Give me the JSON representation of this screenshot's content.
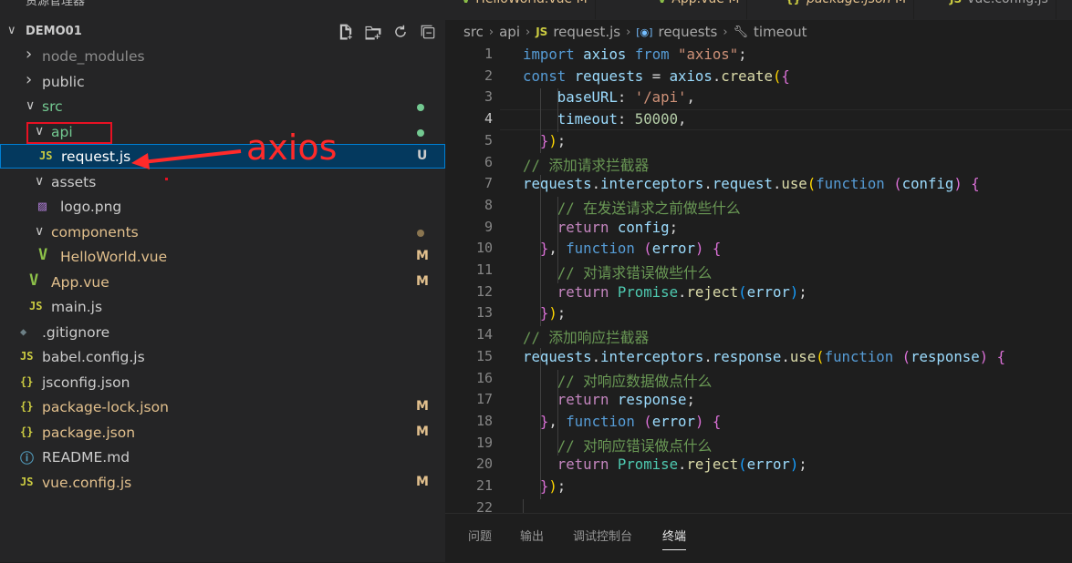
{
  "explorer": {
    "title": "资源管理器",
    "project": "DEMO01",
    "actions": [
      "new-file-icon",
      "new-folder-icon",
      "refresh-icon",
      "collapse-all-icon"
    ],
    "items": [
      {
        "name": "node_modules",
        "type": "folder",
        "open": false,
        "depth": 1,
        "color": "#8c8c8c"
      },
      {
        "name": "public",
        "type": "folder",
        "open": false,
        "depth": 1,
        "color": "#cccccc"
      },
      {
        "name": "src",
        "type": "folder",
        "open": true,
        "depth": 1,
        "color": "#73c991",
        "dot": "#73c991"
      },
      {
        "name": "api",
        "type": "folder",
        "open": true,
        "depth": 2,
        "color": "#73c991",
        "dot": "#73c991"
      },
      {
        "name": "request.js",
        "type": "js",
        "depth": 3,
        "color": "#ffffff",
        "status": "U",
        "statusColor": "#cccccc",
        "selected": true
      },
      {
        "name": "assets",
        "type": "folder",
        "open": true,
        "depth": 2,
        "color": "#cccccc"
      },
      {
        "name": "logo.png",
        "type": "image",
        "depth": 3,
        "color": "#cccccc"
      },
      {
        "name": "components",
        "type": "folder",
        "open": true,
        "depth": 2,
        "color": "#e2c08d",
        "dot": "#8a7550"
      },
      {
        "name": "HelloWorld.vue",
        "type": "vue",
        "depth": 3,
        "color": "#e2c08d",
        "status": "M",
        "statusColor": "#e2c08d"
      },
      {
        "name": "App.vue",
        "type": "vue",
        "depth": 2,
        "color": "#e2c08d",
        "status": "M",
        "statusColor": "#e2c08d"
      },
      {
        "name": "main.js",
        "type": "js",
        "depth": 2,
        "color": "#cccccc"
      },
      {
        "name": ".gitignore",
        "type": "git",
        "depth": 1,
        "color": "#cccccc"
      },
      {
        "name": "babel.config.js",
        "type": "js",
        "depth": 1,
        "color": "#cccccc"
      },
      {
        "name": "jsconfig.json",
        "type": "json",
        "depth": 1,
        "color": "#cccccc"
      },
      {
        "name": "package-lock.json",
        "type": "json",
        "depth": 1,
        "color": "#e2c08d",
        "status": "M",
        "statusColor": "#e2c08d"
      },
      {
        "name": "package.json",
        "type": "json",
        "depth": 1,
        "color": "#e2c08d",
        "status": "M",
        "statusColor": "#e2c08d"
      },
      {
        "name": "README.md",
        "type": "info",
        "depth": 1,
        "color": "#cccccc"
      },
      {
        "name": "vue.config.js",
        "type": "js",
        "depth": 1,
        "color": "#e2c08d",
        "status": "M",
        "statusColor": "#e2c08d"
      }
    ]
  },
  "annotation": {
    "text": "axios"
  },
  "tabs": [
    {
      "label": "HelloWorld.vue",
      "status": "M",
      "icon": "vue"
    },
    {
      "label": "App.vue",
      "status": "M",
      "icon": "vue"
    },
    {
      "label": "package.json",
      "status": "M",
      "icon": "json"
    },
    {
      "label": "vue.config.js",
      "status": "",
      "icon": "js"
    }
  ],
  "breadcrumb": {
    "parts": [
      "src",
      "api",
      "request.js",
      "requests",
      "timeout"
    ]
  },
  "editor": {
    "current_line": 4,
    "lines": [
      {
        "n": "1",
        "tokens": [
          [
            "k",
            "import"
          ],
          [
            "p",
            " "
          ],
          [
            "v",
            "axios"
          ],
          [
            "p",
            " "
          ],
          [
            "k",
            "from"
          ],
          [
            "p",
            " "
          ],
          [
            "s",
            "\"axios\""
          ],
          [
            "p",
            ";"
          ]
        ]
      },
      {
        "n": "2",
        "tokens": [
          [
            "k",
            "const"
          ],
          [
            "p",
            " "
          ],
          [
            "v",
            "requests"
          ],
          [
            "p",
            " = "
          ],
          [
            "v",
            "axios"
          ],
          [
            "p",
            "."
          ],
          [
            "f",
            "create"
          ],
          [
            "b1",
            "("
          ],
          [
            "b2",
            "{"
          ]
        ]
      },
      {
        "n": "3",
        "tokens": [
          [
            "p",
            "    "
          ],
          [
            "v",
            "baseURL"
          ],
          [
            "p",
            ": "
          ],
          [
            "s",
            "'/api'"
          ],
          [
            "p",
            ","
          ]
        ]
      },
      {
        "n": "4",
        "tokens": [
          [
            "p",
            "    "
          ],
          [
            "v",
            "timeout"
          ],
          [
            "p",
            ": "
          ],
          [
            "n",
            "50000"
          ],
          [
            "p",
            ","
          ]
        ]
      },
      {
        "n": "5",
        "tokens": [
          [
            "p",
            "  "
          ],
          [
            "b2",
            "}"
          ],
          [
            "b1",
            ")"
          ],
          [
            "p",
            ";"
          ]
        ]
      },
      {
        "n": "6",
        "tokens": [
          [
            "cm",
            "// 添加请求拦截器"
          ]
        ]
      },
      {
        "n": "7",
        "tokens": [
          [
            "v",
            "requests"
          ],
          [
            "p",
            "."
          ],
          [
            "v",
            "interceptors"
          ],
          [
            "p",
            "."
          ],
          [
            "v",
            "request"
          ],
          [
            "p",
            "."
          ],
          [
            "f",
            "use"
          ],
          [
            "b1",
            "("
          ],
          [
            "k",
            "function"
          ],
          [
            "p",
            " "
          ],
          [
            "b2",
            "("
          ],
          [
            "v",
            "config"
          ],
          [
            "b2",
            ")"
          ],
          [
            "p",
            " "
          ],
          [
            "b2",
            "{"
          ]
        ]
      },
      {
        "n": "8",
        "tokens": [
          [
            "p",
            "    "
          ],
          [
            "cm",
            "// 在发送请求之前做些什么"
          ]
        ]
      },
      {
        "n": "9",
        "tokens": [
          [
            "p",
            "    "
          ],
          [
            "c",
            "return"
          ],
          [
            "p",
            " "
          ],
          [
            "v",
            "config"
          ],
          [
            "p",
            ";"
          ]
        ]
      },
      {
        "n": "10",
        "tokens": [
          [
            "p",
            "  "
          ],
          [
            "b2",
            "}"
          ],
          [
            "p",
            ", "
          ],
          [
            "k",
            "function"
          ],
          [
            "p",
            " "
          ],
          [
            "b2",
            "("
          ],
          [
            "v",
            "error"
          ],
          [
            "b2",
            ")"
          ],
          [
            "p",
            " "
          ],
          [
            "b2",
            "{"
          ]
        ]
      },
      {
        "n": "11",
        "tokens": [
          [
            "p",
            "    "
          ],
          [
            "cm",
            "// 对请求错误做些什么"
          ]
        ]
      },
      {
        "n": "12",
        "tokens": [
          [
            "p",
            "    "
          ],
          [
            "c",
            "return"
          ],
          [
            "p",
            " "
          ],
          [
            "t",
            "Promise"
          ],
          [
            "p",
            "."
          ],
          [
            "f",
            "reject"
          ],
          [
            "b3",
            "("
          ],
          [
            "v",
            "error"
          ],
          [
            "b3",
            ")"
          ],
          [
            "p",
            ";"
          ]
        ]
      },
      {
        "n": "13",
        "tokens": [
          [
            "p",
            "  "
          ],
          [
            "b2",
            "}"
          ],
          [
            "b1",
            ")"
          ],
          [
            "p",
            ";"
          ]
        ]
      },
      {
        "n": "14",
        "tokens": [
          [
            "cm",
            "// 添加响应拦截器"
          ]
        ]
      },
      {
        "n": "15",
        "tokens": [
          [
            "v",
            "requests"
          ],
          [
            "p",
            "."
          ],
          [
            "v",
            "interceptors"
          ],
          [
            "p",
            "."
          ],
          [
            "v",
            "response"
          ],
          [
            "p",
            "."
          ],
          [
            "f",
            "use"
          ],
          [
            "b1",
            "("
          ],
          [
            "k",
            "function"
          ],
          [
            "p",
            " "
          ],
          [
            "b2",
            "("
          ],
          [
            "v",
            "response"
          ],
          [
            "b2",
            ")"
          ],
          [
            "p",
            " "
          ],
          [
            "b2",
            "{"
          ]
        ]
      },
      {
        "n": "16",
        "tokens": [
          [
            "p",
            "    "
          ],
          [
            "cm",
            "// 对响应数据做点什么"
          ]
        ]
      },
      {
        "n": "17",
        "tokens": [
          [
            "p",
            "    "
          ],
          [
            "c",
            "return"
          ],
          [
            "p",
            " "
          ],
          [
            "v",
            "response"
          ],
          [
            "p",
            ";"
          ]
        ]
      },
      {
        "n": "18",
        "tokens": [
          [
            "p",
            "  "
          ],
          [
            "b2",
            "}"
          ],
          [
            "p",
            ", "
          ],
          [
            "k",
            "function"
          ],
          [
            "p",
            " "
          ],
          [
            "b2",
            "("
          ],
          [
            "v",
            "error"
          ],
          [
            "b2",
            ")"
          ],
          [
            "p",
            " "
          ],
          [
            "b2",
            "{"
          ]
        ]
      },
      {
        "n": "19",
        "tokens": [
          [
            "p",
            "    "
          ],
          [
            "cm",
            "// 对响应错误做点什么"
          ]
        ]
      },
      {
        "n": "20",
        "tokens": [
          [
            "p",
            "    "
          ],
          [
            "c",
            "return"
          ],
          [
            "p",
            " "
          ],
          [
            "t",
            "Promise"
          ],
          [
            "p",
            "."
          ],
          [
            "f",
            "reject"
          ],
          [
            "b3",
            "("
          ],
          [
            "v",
            "error"
          ],
          [
            "b3",
            ")"
          ],
          [
            "p",
            ";"
          ]
        ]
      },
      {
        "n": "21",
        "tokens": [
          [
            "p",
            "  "
          ],
          [
            "b2",
            "}"
          ],
          [
            "b1",
            ")"
          ],
          [
            "p",
            ";"
          ]
        ]
      },
      {
        "n": "22",
        "tokens": []
      }
    ]
  },
  "panel": {
    "tabs": [
      "问题",
      "输出",
      "调试控制台",
      "终端"
    ],
    "active": "终端"
  }
}
